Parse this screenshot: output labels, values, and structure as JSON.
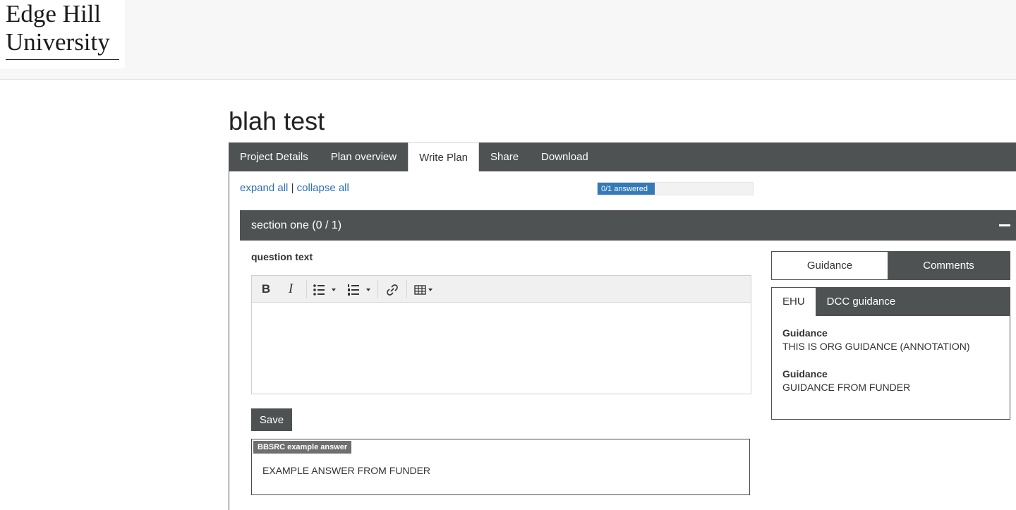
{
  "header": {
    "logo_line1": "Edge Hill",
    "logo_line2": "University"
  },
  "plan": {
    "title": "blah test"
  },
  "tabs": [
    {
      "label": "Project Details"
    },
    {
      "label": "Plan overview"
    },
    {
      "label": "Write Plan",
      "active": true
    },
    {
      "label": "Share"
    },
    {
      "label": "Download"
    }
  ],
  "controls": {
    "expand_all": "expand all",
    "separator": "|",
    "collapse_all": "collapse all"
  },
  "progress": {
    "label": "0/1 answered",
    "answered": 0,
    "total": 1,
    "indicator_fill_fraction": 0.37
  },
  "section": {
    "title": "section one (0 / 1)"
  },
  "question": {
    "text": "question text",
    "answer_value": ""
  },
  "editor": {
    "toolbar": [
      {
        "name": "bold-icon",
        "glyph": "B"
      },
      {
        "name": "italic-icon",
        "glyph": "I"
      },
      {
        "name": "bullet-list-icon",
        "glyph": "☰▾"
      },
      {
        "name": "numbered-list-icon",
        "glyph": "☰▾"
      },
      {
        "name": "link-icon",
        "glyph": "🔗"
      },
      {
        "name": "table-icon",
        "glyph": "▦▾"
      }
    ]
  },
  "save_label": "Save",
  "example_answer": {
    "badge": "BBSRC example answer",
    "text": "EXAMPLE ANSWER FROM FUNDER"
  },
  "side_panel": {
    "tabs": [
      "Guidance",
      "Comments"
    ],
    "guidance_tabs": [
      "EHU",
      "DCC guidance"
    ],
    "entries": [
      {
        "heading": "Guidance",
        "text": "THIS IS ORG GUIDANCE (ANNOTATION)"
      },
      {
        "heading": "Guidance",
        "text": "GUIDANCE FROM FUNDER"
      }
    ]
  },
  "colors": {
    "dark_bar": "#4f5253",
    "link": "#2a6ebb",
    "progress": "#337ab7"
  }
}
